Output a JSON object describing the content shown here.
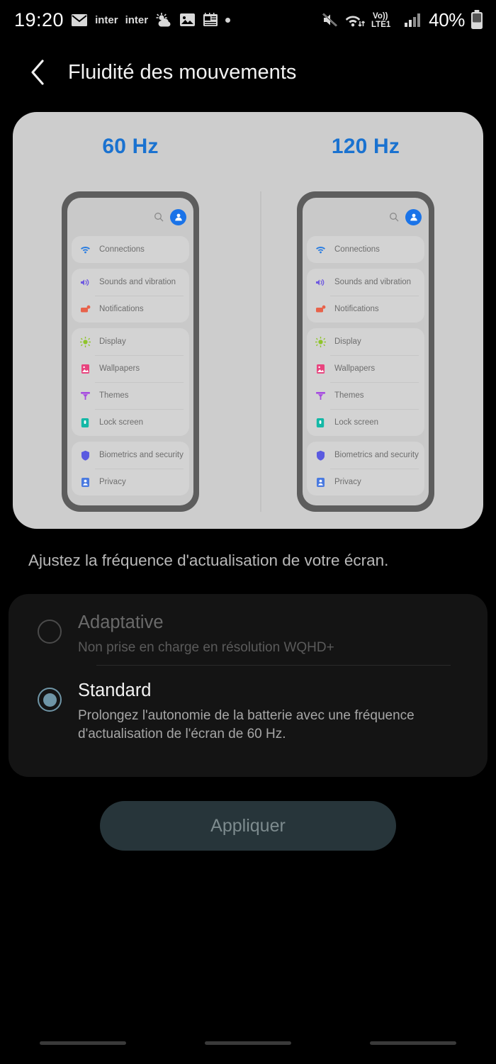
{
  "status_bar": {
    "time": "19:20",
    "left_icons": [
      {
        "name": "email-icon",
        "label": ""
      },
      {
        "name": "app-label-inter-1",
        "label": "inter"
      },
      {
        "name": "app-label-inter-2",
        "label": "inter"
      },
      {
        "name": "weather-icon",
        "label": ""
      },
      {
        "name": "gallery-icon",
        "label": ""
      },
      {
        "name": "news-icon",
        "label": ""
      },
      {
        "name": "more-dot-icon",
        "label": ""
      }
    ],
    "right_icons": [
      {
        "name": "mute-icon"
      },
      {
        "name": "wifi-icon"
      },
      {
        "name": "volte-icon",
        "label_top": "Vo))",
        "label_bottom": "LTE1"
      },
      {
        "name": "signal-bars-icon"
      }
    ],
    "battery_percent": "40%"
  },
  "header": {
    "back_label": "",
    "title": "Fluidité des mouvements"
  },
  "preview": {
    "left_label": "60 Hz",
    "right_label": "120 Hz",
    "accent_color": "#1a72d0",
    "phone_mock": {
      "search_icon": "search-icon",
      "avatar_icon": "account-avatar-icon",
      "groups": [
        {
          "rows": [
            {
              "label": "Connections",
              "icon": "wifi-icon",
              "color": "#2a7de1"
            }
          ]
        },
        {
          "rows": [
            {
              "label": "Sounds and vibration",
              "icon": "speaker-icon",
              "color": "#6f5ae0"
            },
            {
              "label": "Notifications",
              "icon": "notification-icon",
              "color": "#e8624a"
            }
          ]
        },
        {
          "rows": [
            {
              "label": "Display",
              "icon": "brightness-icon",
              "color": "#8fc42a"
            },
            {
              "label": "Wallpapers",
              "icon": "wallpaper-icon",
              "color": "#e8447e"
            },
            {
              "label": "Themes",
              "icon": "themes-icon",
              "color": "#a64ae0"
            },
            {
              "label": "Lock screen",
              "icon": "lock-icon",
              "color": "#12b municipal"
            }
          ]
        },
        {
          "rows": [
            {
              "label": "Biometrics and security",
              "icon": "shield-icon",
              "color": "#5a5ae0"
            },
            {
              "label": "Privacy",
              "icon": "privacy-icon",
              "color": "#4a7ae0"
            }
          ]
        }
      ]
    }
  },
  "helper_text": "Ajustez la fréquence d'actualisation de votre écran.",
  "options": [
    {
      "id": "adaptive",
      "title": "Adaptative",
      "description": "Non prise en charge en résolution WQHD+",
      "selected": false,
      "enabled": false
    },
    {
      "id": "standard",
      "title": "Standard",
      "description": "Prolongez l'autonomie de la batterie avec une fréquence d'actualisation de l'écran de 60 Hz.",
      "selected": true,
      "enabled": true
    }
  ],
  "apply_button": {
    "label": "Appliquer",
    "enabled": false,
    "bg_color": "#27353a",
    "text_color": "#7d8b8e"
  },
  "nav_bar": {
    "items": [
      "recents-line",
      "home-line",
      "back-line"
    ]
  }
}
